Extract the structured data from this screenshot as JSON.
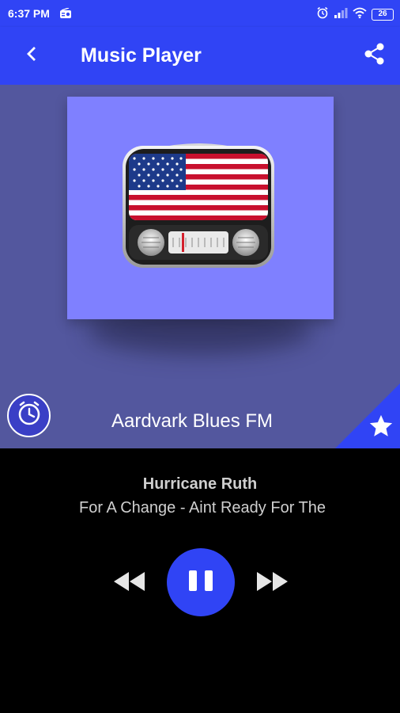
{
  "status_bar": {
    "time": "6:37 PM",
    "battery": "26",
    "icons": [
      "radio-icon",
      "alarm-icon",
      "signal-icon",
      "wifi-icon",
      "battery-icon"
    ]
  },
  "app_bar": {
    "title": "Music Player",
    "icons": [
      "back-arrow-icon",
      "share-icon"
    ]
  },
  "station": {
    "name": "Aardvark Blues FM",
    "artwork": "usa-flag-radio",
    "icons": [
      "timer-clock-icon",
      "favorite-star-icon"
    ]
  },
  "now_playing": {
    "artist": "Hurricane Ruth",
    "title": "For A Change - Aint Ready For The",
    "state": "playing",
    "icons": [
      "previous-icon",
      "pause-icon",
      "next-icon"
    ]
  },
  "colors": {
    "primary": "#3044f5",
    "hero_background": "#53579e",
    "artwork_background": "#7f80ff",
    "player_background": "#000000",
    "text_secondary": "#cfcfcf"
  }
}
